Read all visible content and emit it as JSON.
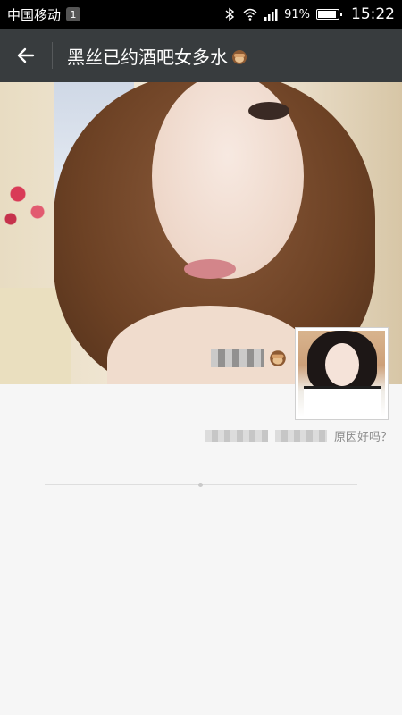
{
  "status_bar": {
    "carrier": "中国移动",
    "notification_count": "1",
    "battery_percent": "91%",
    "battery_level": 0.91,
    "time": "15:22",
    "icons": [
      "bluetooth-icon",
      "wifi-icon",
      "signal-icon",
      "battery-icon"
    ]
  },
  "header": {
    "back_icon": "back-arrow-icon",
    "title": "黑丝已约酒吧女多水",
    "title_emoji": "see-no-evil-monkey-icon"
  },
  "profile": {
    "name_emoji": "see-no-evil-monkey-icon",
    "signature_text": "原因好吗？"
  },
  "colors": {
    "status_bar_bg": "#000000",
    "title_bar_bg": "#383c3e",
    "page_bg": "#f6f6f6",
    "signature_text": "#8c8c8c"
  }
}
